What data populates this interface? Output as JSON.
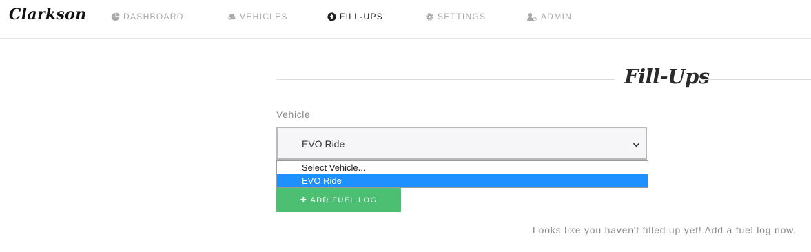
{
  "app": {
    "brand": "Clarkson"
  },
  "nav": {
    "items": [
      {
        "label": "DASHBOARD",
        "icon": "pie-chart-icon",
        "active": false
      },
      {
        "label": "VEHICLES",
        "icon": "car-icon",
        "active": false
      },
      {
        "label": "FILL-UPS",
        "icon": "arrow-circle-up-icon",
        "active": true
      },
      {
        "label": "SETTINGS",
        "icon": "gear-icon",
        "active": false
      },
      {
        "label": "ADMIN",
        "icon": "user-gear-icon",
        "active": false
      }
    ]
  },
  "page": {
    "title": "Fill-Ups"
  },
  "vehicle_field": {
    "label": "Vehicle",
    "selected": "EVO Ride",
    "options": [
      "Select Vehicle...",
      "EVO Ride"
    ],
    "highlighted_option": "EVO Ride"
  },
  "actions": {
    "add_fuel_log": "ADD FUEL LOG",
    "add_icon": "plus-icon"
  },
  "empty_state": {
    "message": "Looks like you haven't filled up yet! Add a fuel log now."
  },
  "colors": {
    "accent_green": "#4cbf73",
    "highlight_blue": "#1e90ff",
    "nav_inactive": "#a9a9a9",
    "nav_active": "#222222"
  }
}
